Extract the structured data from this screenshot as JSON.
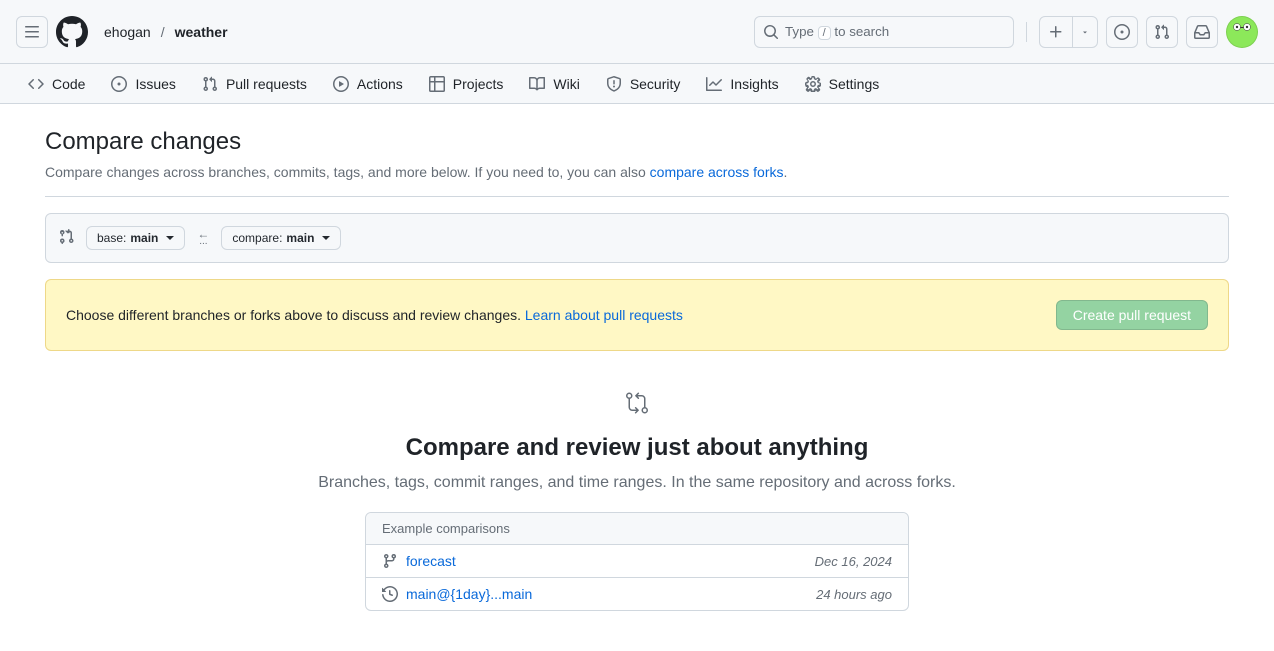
{
  "breadcrumb": {
    "owner": "ehogan",
    "repo": "weather"
  },
  "search": {
    "prefix": "Type ",
    "key": "/",
    "suffix": " to search"
  },
  "nav": {
    "code": "Code",
    "issues": "Issues",
    "pulls": "Pull requests",
    "actions": "Actions",
    "projects": "Projects",
    "wiki": "Wiki",
    "security": "Security",
    "insights": "Insights",
    "settings": "Settings"
  },
  "page": {
    "title": "Compare changes",
    "subtitle_a": "Compare changes across branches, commits, tags, and more below. If you need to, you can also ",
    "subtitle_link": "compare across forks",
    "subtitle_b": "."
  },
  "range": {
    "base_label": "base: ",
    "base_value": "main",
    "compare_label": "compare: ",
    "compare_value": "main"
  },
  "flash": {
    "text": "Choose different branches or forks above to discuss and review changes. ",
    "link": "Learn about pull requests",
    "button": "Create pull request"
  },
  "blankslate": {
    "title": "Compare and review just about anything",
    "desc": "Branches, tags, commit ranges, and time ranges. In the same repository and across forks.",
    "examples_header": "Example comparisons",
    "examples": [
      {
        "name": "forecast",
        "date": "Dec 16, 2024",
        "icon": "branch"
      },
      {
        "name": "main@{1day}...main",
        "date": "24 hours ago",
        "icon": "history"
      }
    ]
  }
}
